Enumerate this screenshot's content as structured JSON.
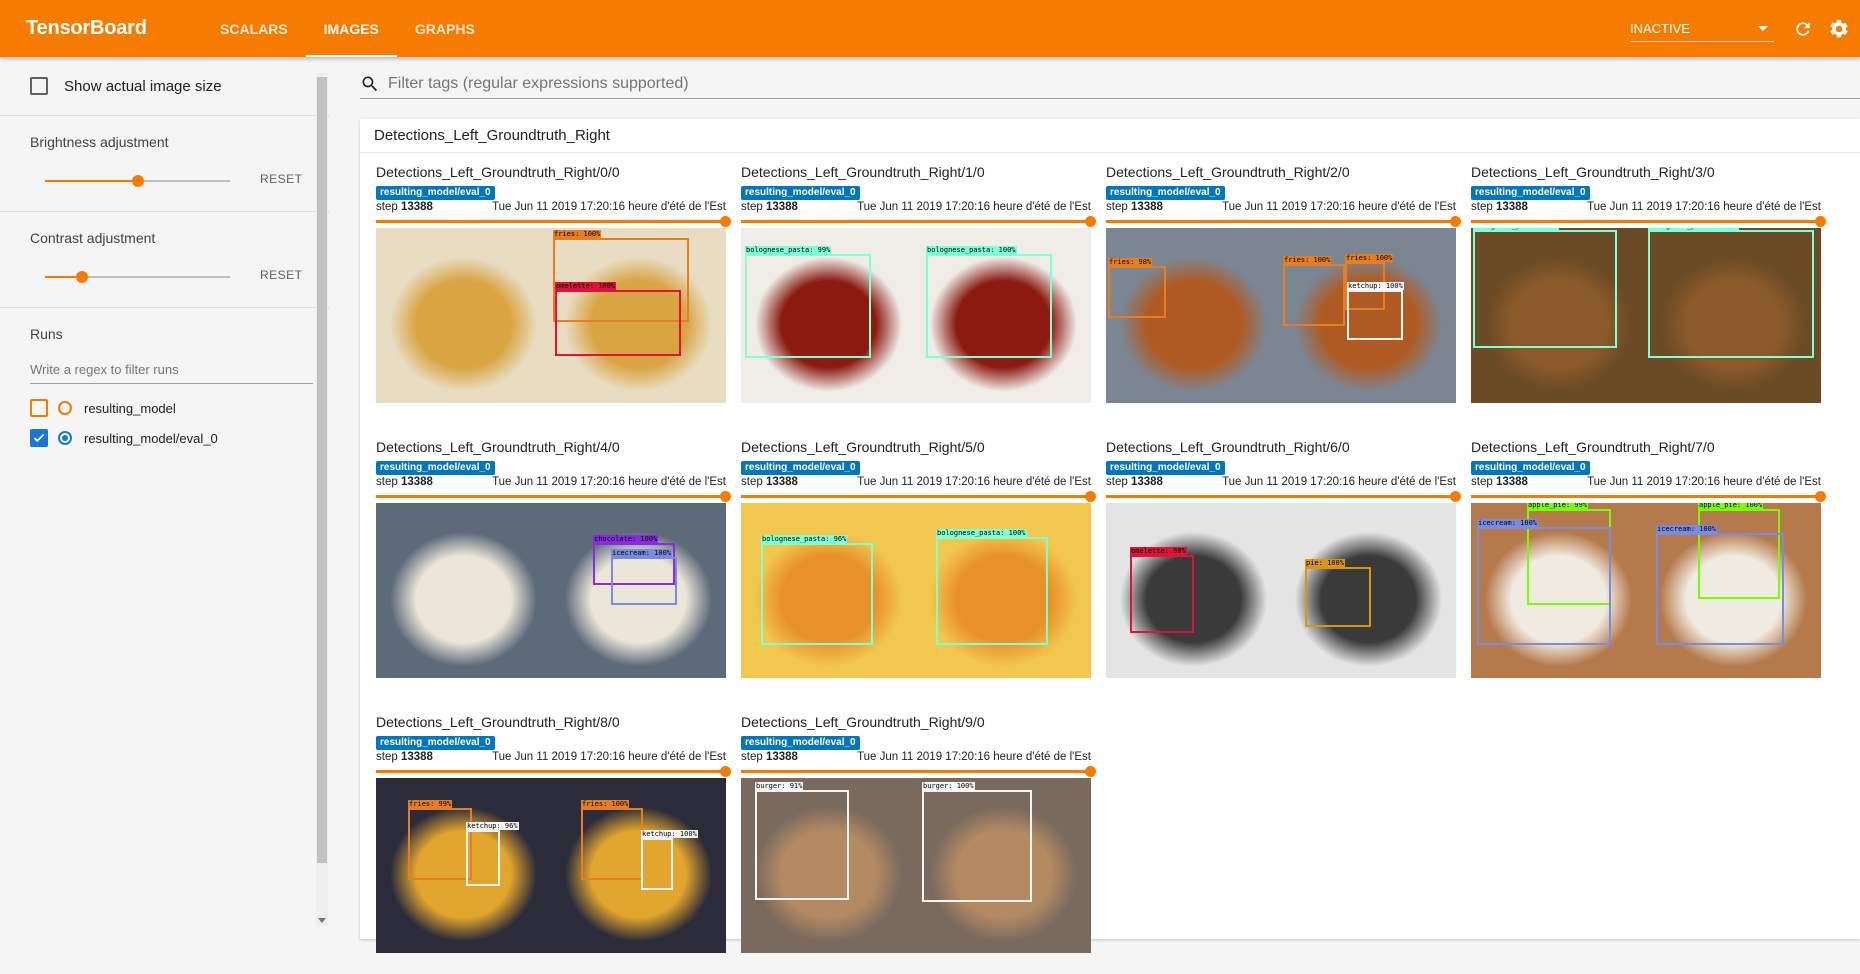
{
  "app": {
    "title": "TensorBoard"
  },
  "tabs": [
    {
      "label": "SCALARS",
      "active": false
    },
    {
      "label": "IMAGES",
      "active": true
    },
    {
      "label": "GRAPHS",
      "active": false
    }
  ],
  "status_select": {
    "value": "INACTIVE"
  },
  "sidebar": {
    "show_actual_size": "Show actual image size",
    "brightness": {
      "label": "Brightness adjustment",
      "reset": "RESET",
      "value": 0.5
    },
    "contrast": {
      "label": "Contrast adjustment",
      "reset": "RESET",
      "value": 0.2
    },
    "runs": {
      "label": "Runs",
      "filter_placeholder": "Write a regex to filter runs",
      "items": [
        {
          "name": "resulting_model",
          "checked": false,
          "selected": false
        },
        {
          "name": "resulting_model/eval_0",
          "checked": true,
          "selected": true
        }
      ]
    }
  },
  "main": {
    "filter_placeholder": "Filter tags (regular expressions supported)",
    "card_title": "Detections_Left_Groundtruth_Right",
    "images": [
      {
        "title": "Detections_Left_Groundtruth_Right/0/0",
        "run": "resulting_model/eval_0",
        "step_label": "step",
        "step": "13388",
        "time": "Tue Jun 11 2019 17:20:16 heure d'été de l'Est"
      },
      {
        "title": "Detections_Left_Groundtruth_Right/1/0",
        "run": "resulting_model/eval_0",
        "step_label": "step",
        "step": "13388",
        "time": "Tue Jun 11 2019 17:20:16 heure d'été de l'Est"
      },
      {
        "title": "Detections_Left_Groundtruth_Right/2/0",
        "run": "resulting_model/eval_0",
        "step_label": "step",
        "step": "13388",
        "time": "Tue Jun 11 2019 17:20:16 heure d'été de l'Est"
      },
      {
        "title": "Detections_Left_Groundtruth_Right/3/0",
        "run": "resulting_model/eval_0",
        "step_label": "step",
        "step": "13388",
        "time": "Tue Jun 11 2019 17:20:16 heure d'été de l'Est"
      },
      {
        "title": "Detections_Left_Groundtruth_Right/4/0",
        "run": "resulting_model/eval_0",
        "step_label": "step",
        "step": "13388",
        "time": "Tue Jun 11 2019 17:20:16 heure d'été de l'Est"
      },
      {
        "title": "Detections_Left_Groundtruth_Right/5/0",
        "run": "resulting_model/eval_0",
        "step_label": "step",
        "step": "13388",
        "time": "Tue Jun 11 2019 17:20:16 heure d'été de l'Est"
      },
      {
        "title": "Detections_Left_Groundtruth_Right/6/0",
        "run": "resulting_model/eval_0",
        "step_label": "step",
        "step": "13388",
        "time": "Tue Jun 11 2019 17:20:16 heure d'été de l'Est"
      },
      {
        "title": "Detections_Left_Groundtruth_Right/7/0",
        "run": "resulting_model/eval_0",
        "step_label": "step",
        "step": "13388",
        "time": "Tue Jun 11 2019 17:20:16 heure d'été de l'Est"
      },
      {
        "title": "Detections_Left_Groundtruth_Right/8/0",
        "run": "resulting_model/eval_0",
        "step_label": "step",
        "step": "13388",
        "time": "Tue Jun 11 2019 17:20:16 heure d'été de l'Est"
      },
      {
        "title": "Detections_Left_Groundtruth_Right/9/0",
        "run": "resulting_model/eval_0",
        "step_label": "step",
        "step": "13388",
        "time": "Tue Jun 11 2019 17:20:16 heure d'été de l'Est"
      }
    ]
  },
  "detections": [
    {
      "bg": "#e8dcc2",
      "fg": "#d9a441",
      "left": [],
      "right": [
        {
          "label": "fries: 100%",
          "color": "#e67e22"
        },
        {
          "label": "omelette: 100%",
          "color": "#dc143c"
        }
      ]
    },
    {
      "bg": "#f0ece8",
      "fg": "#8b1a10",
      "left": [
        {
          "label": "bolognese_pasta: 99%",
          "color": "#7fffd4"
        }
      ],
      "right": [
        {
          "label": "bolognese_pasta: 100%",
          "color": "#7fffd4"
        }
      ]
    },
    {
      "bg": "#7c8592",
      "fg": "#b05a23",
      "left": [
        {
          "label": "fries: 98%",
          "color": "#e67e22"
        }
      ],
      "right": [
        {
          "label": "fries: 100%",
          "color": "#e67e22"
        },
        {
          "label": "fries: 100%",
          "color": "#e67e22"
        },
        {
          "label": "ketchup: 100%",
          "color": "#f5f5f5"
        }
      ]
    },
    {
      "bg": "#6b4a26",
      "fg": "#8a5a2a",
      "left": [
        {
          "label": "bolognese_pasta: 99%",
          "color": "#7fffd4"
        }
      ],
      "right": [
        {
          "label": "bolognese_pasta: 100%",
          "color": "#7fffd4"
        }
      ]
    },
    {
      "bg": "#5d6a7a",
      "fg": "#ece6d8",
      "left": [],
      "right": [
        {
          "label": "chocolate: 100%",
          "color": "#8a2be2"
        },
        {
          "label": "icecream: 100%",
          "color": "#7b8ce0"
        }
      ]
    },
    {
      "bg": "#f2c74d",
      "fg": "#e8912a",
      "left": [
        {
          "label": "bolognese_pasta: 96%",
          "color": "#7fffd4"
        }
      ],
      "right": [
        {
          "label": "bolognese_pasta: 100%",
          "color": "#7fffd4"
        }
      ]
    },
    {
      "bg": "#e4e4e4",
      "fg": "#3a3a3a",
      "left": [
        {
          "label": "omelette: 98%",
          "color": "#dc143c"
        }
      ],
      "right": [
        {
          "label": "pie: 100%",
          "color": "#d89614"
        }
      ]
    },
    {
      "bg": "#b57a4c",
      "fg": "#f0ebe0",
      "left": [
        {
          "label": "apple_pie: 99%",
          "color": "#7cfc00"
        },
        {
          "label": "icecream: 100%",
          "color": "#7b8ce0"
        }
      ],
      "right": [
        {
          "label": "apple_pie: 100%",
          "color": "#7cfc00"
        },
        {
          "label": "icecream: 100%",
          "color": "#7b8ce0"
        }
      ]
    },
    {
      "bg": "#2b2b3a",
      "fg": "#e2a52e",
      "left": [
        {
          "label": "fries: 99%",
          "color": "#e67e22"
        },
        {
          "label": "ketchup: 96%",
          "color": "#f5f5f5"
        }
      ],
      "right": [
        {
          "label": "fries: 100%",
          "color": "#e67e22"
        },
        {
          "label": "ketchup: 100%",
          "color": "#f5f5f5"
        }
      ]
    },
    {
      "bg": "#7a6a5e",
      "fg": "#b48a62",
      "left": [
        {
          "label": "burger: 91%",
          "color": "#f5f5f5"
        }
      ],
      "right": [
        {
          "label": "burger: 100%",
          "color": "#f5f5f5"
        }
      ]
    }
  ]
}
